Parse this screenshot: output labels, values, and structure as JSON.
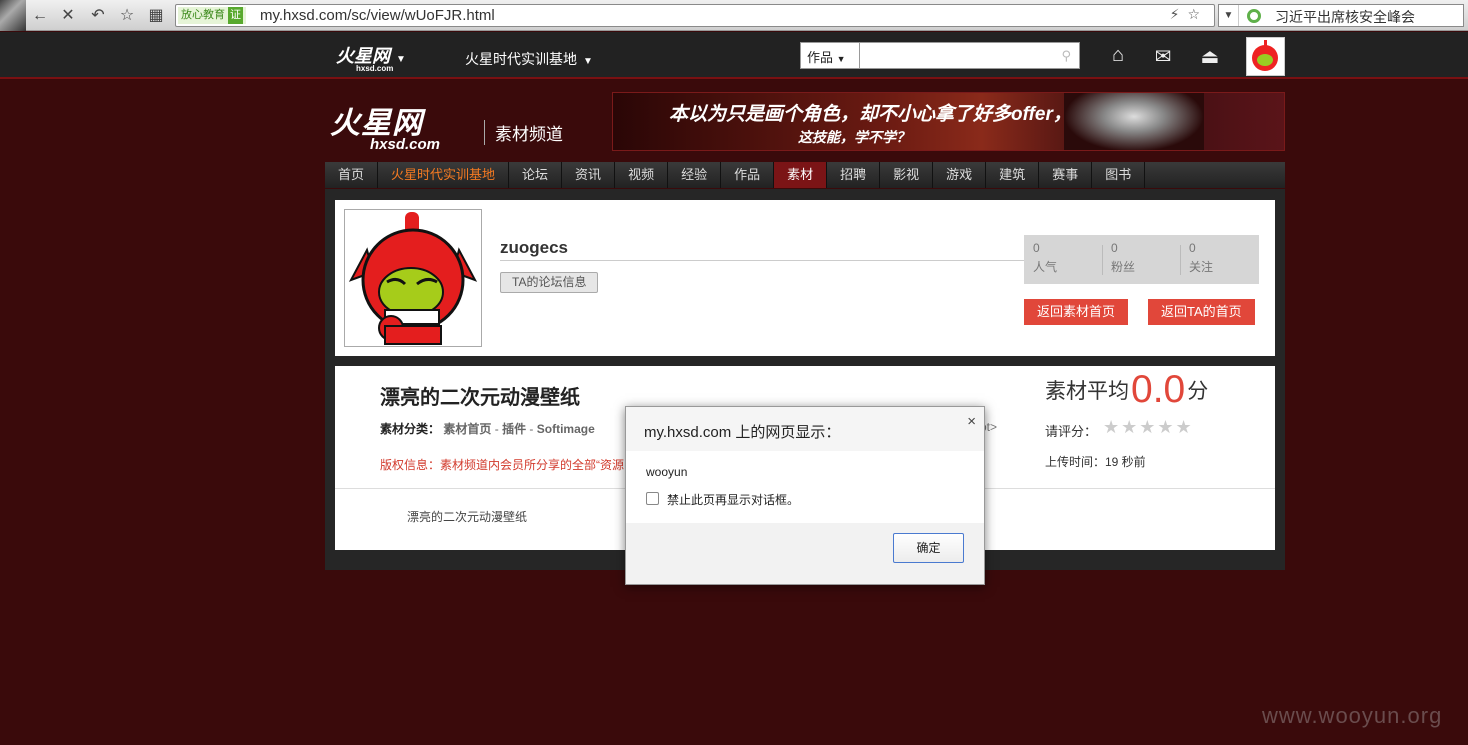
{
  "browser": {
    "secure_badge": "放心教育",
    "secure_tag": "证",
    "url": "my.hxsd.com/sc/view/wUoFJR.html",
    "news_text": "习近平出席核安全峰会"
  },
  "topbar": {
    "logo_text": "火星网",
    "logo_sub": "hxsd.com",
    "base_link": "火星时代实训基地",
    "search_category": "作品"
  },
  "header": {
    "logo_text": "火星网",
    "logo_sub": "hxsd.com",
    "channel": "素材频道",
    "banner_line1": "本以为只是画个角色，却不小心拿了好多offer，",
    "banner_line2": "这技能，学不学？"
  },
  "nav": {
    "items": [
      "首页",
      "火星时代实训基地",
      "论坛",
      "资讯",
      "视频",
      "经验",
      "作品",
      "素材",
      "招聘",
      "影视",
      "游戏",
      "建筑",
      "赛事",
      "图书"
    ]
  },
  "profile": {
    "username": "zuogecs",
    "forum_button": "TA的论坛信息",
    "stats": [
      {
        "value": "0",
        "label": "人气"
      },
      {
        "value": "0",
        "label": "粉丝"
      },
      {
        "value": "0",
        "label": "关注"
      }
    ],
    "back_material_button": "返回素材首页",
    "back_home_button": "返回TA的首页"
  },
  "material": {
    "title": "漂亮的二次元动漫壁纸",
    "category_label": "素材分类：",
    "category_path": [
      "素材首页",
      "插件",
      "Softimage"
    ],
    "copyright": "版权信息：素材频道内会员所分享的全部“资源",
    "next_fragment": "ot>",
    "description": "漂亮的二次元动漫壁纸",
    "avg_label": "素材平均",
    "avg_score": "0.0",
    "avg_unit": "分",
    "rate_label": "请评分：",
    "stars": "★★★★★",
    "upload_time": "上传时间：19 秒前"
  },
  "dialog": {
    "title": "my.hxsd.com 上的网页显示：",
    "message": "wooyun",
    "checkbox_label": "禁止此页再显示对话框。",
    "ok_button": "确定",
    "close": "×"
  },
  "watermark": "www.wooyun.org"
}
